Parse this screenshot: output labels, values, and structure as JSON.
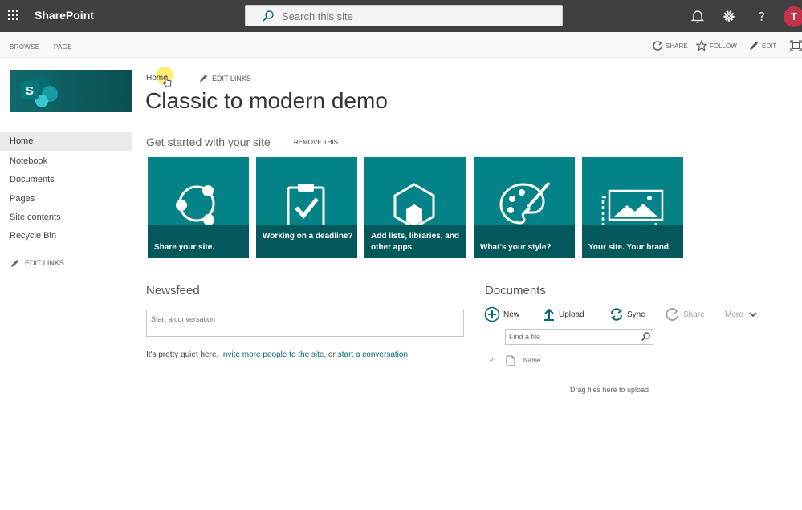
{
  "suite": {
    "app_name": "SharePoint",
    "search_placeholder": "Search this site",
    "avatar_initial": "T"
  },
  "ribbon": {
    "tabs": [
      "BROWSE",
      "PAGE"
    ],
    "actions": {
      "share": "SHARE",
      "follow": "FOLLOW",
      "edit": "EDIT"
    }
  },
  "nav": {
    "items": [
      "Home",
      "Notebook",
      "Documents",
      "Pages",
      "Site contents",
      "Recycle Bin"
    ],
    "selected": "Home",
    "edit_links": "EDIT LINKS"
  },
  "header": {
    "breadcrumb": "Home",
    "edit_links": "EDIT LINKS",
    "page_title": "Classic to modern demo"
  },
  "get_started": {
    "title": "Get started with your site",
    "remove_label": "REMOVE THIS",
    "tiles": [
      {
        "label": "Share your site.",
        "icon": "share-nodes-icon"
      },
      {
        "label": "Working on a deadline?",
        "icon": "clipboard-check-icon"
      },
      {
        "label": "Add lists, libraries, and other apps.",
        "icon": "hexagon-app-icon"
      },
      {
        "label": "What's your style?",
        "icon": "palette-icon"
      },
      {
        "label": "Your site. Your brand.",
        "icon": "picture-frame-icon"
      }
    ],
    "tile_color": "#038387",
    "tile_band_color": "#02585b"
  },
  "newsfeed": {
    "title": "Newsfeed",
    "placeholder": "Start a conversation",
    "quiet_prefix": "It's pretty quiet here.",
    "quiet_link1": "Invite more people to the site,",
    "quiet_mid": "or",
    "quiet_link2": "start a conversation."
  },
  "documents": {
    "title": "Documents",
    "commands": {
      "new": "New",
      "upload": "Upload",
      "sync": "Sync",
      "share": "Share",
      "more": "More"
    },
    "find_placeholder": "Find a file",
    "column_name": "Name",
    "drag_text": "Drag files here to upload"
  }
}
